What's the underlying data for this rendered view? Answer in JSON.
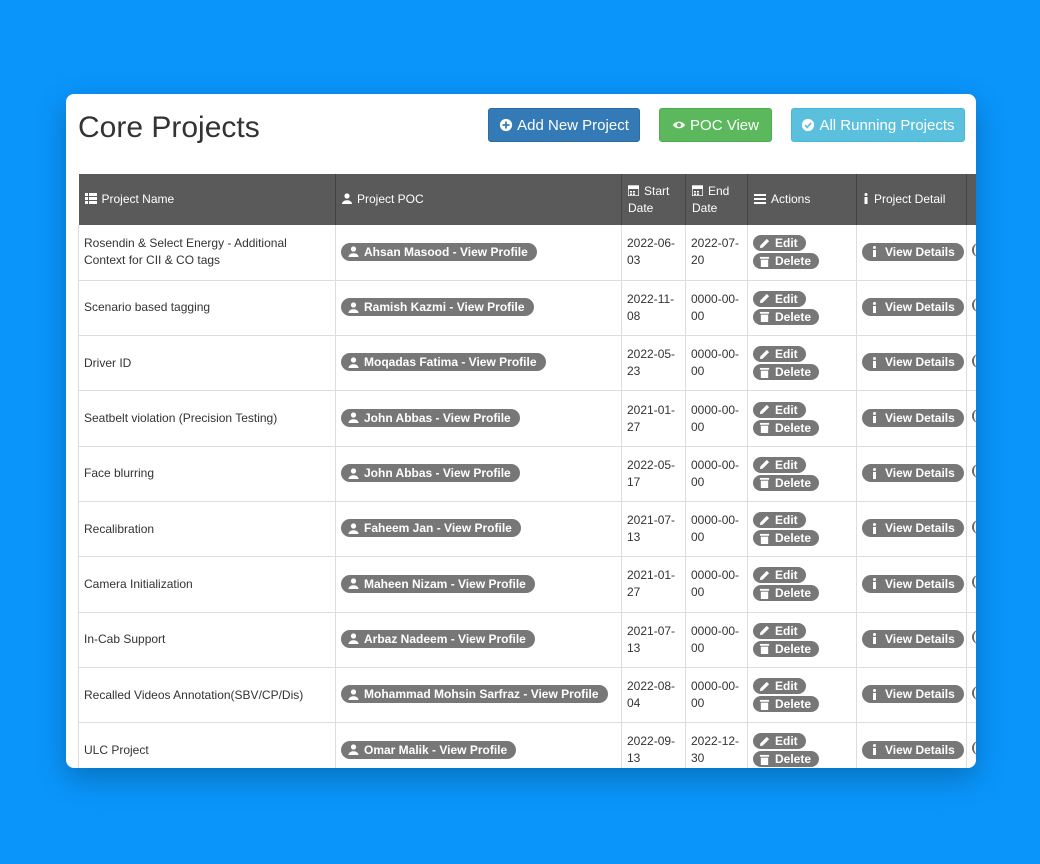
{
  "header": {
    "title": "Core Projects",
    "add_label": "Add New Project",
    "poc_label": "POC View",
    "running_label": "All Running Projects"
  },
  "table": {
    "columns": {
      "name": "Project Name",
      "poc": "Project POC",
      "start": "Start Date",
      "end": "End Date",
      "actions": "Actions",
      "detail": "Project Detail"
    },
    "edit_label": "Edit",
    "delete_label": "Delete",
    "details_label": "View Details",
    "rows": [
      {
        "name": "Rosendin & Select Energy - Additional Context for CII & CO tags",
        "poc": "Ahsan Masood - View Profile",
        "start": "2022-06-03",
        "end": "2022-07-20"
      },
      {
        "name": "Scenario based tagging",
        "poc": "Ramish Kazmi - View Profile",
        "start": "2022-11-08",
        "end": "0000-00-00"
      },
      {
        "name": "Driver ID",
        "poc": "Moqadas Fatima - View Profile",
        "start": "2022-05-23",
        "end": "0000-00-00"
      },
      {
        "name": "Seatbelt violation (Precision Testing)",
        "poc": "John Abbas - View Profile",
        "start": "2021-01-27",
        "end": "0000-00-00"
      },
      {
        "name": "Face blurring",
        "poc": "John Abbas - View Profile",
        "start": "2022-05-17",
        "end": "0000-00-00"
      },
      {
        "name": "Recalibration",
        "poc": "Faheem Jan - View Profile",
        "start": "2021-07-13",
        "end": "0000-00-00"
      },
      {
        "name": "Camera Initialization",
        "poc": "Maheen Nizam - View Profile",
        "start": "2021-01-27",
        "end": "0000-00-00"
      },
      {
        "name": "In-Cab Support",
        "poc": "Arbaz Nadeem - View Profile",
        "start": "2021-07-13",
        "end": "0000-00-00"
      },
      {
        "name": "Recalled Videos Annotation(SBV/CP/Dis)",
        "poc": "Mohammad Mohsin Sarfraz - View Profile",
        "start": "2022-08-04",
        "end": "0000-00-00"
      },
      {
        "name": "ULC Project",
        "poc": "Omar Malik - View Profile",
        "start": "2022-09-13",
        "end": "2022-12-30"
      }
    ]
  },
  "colors": {
    "background": "#0a95fb",
    "primary": "#337ab7",
    "success": "#5cb85c",
    "info": "#5bc0de",
    "header_row": "#5a5a5a",
    "pill": "#777777"
  }
}
